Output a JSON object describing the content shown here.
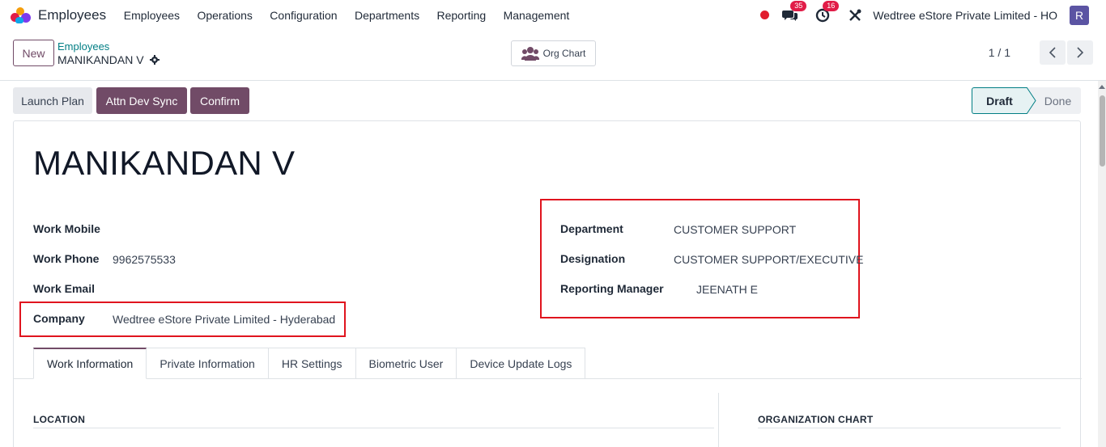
{
  "navbar": {
    "app_title": "Employees",
    "menu": [
      "Employees",
      "Operations",
      "Configuration",
      "Departments",
      "Reporting",
      "Management"
    ],
    "messages_count": "35",
    "activities_count": "16",
    "company": "Wedtree eStore Private Limited - HO",
    "avatar_initial": "R"
  },
  "control": {
    "new_label": "New",
    "breadcrumb": "Employees",
    "record_name": "MANIKANDAN V",
    "org_chart_label": "Org Chart",
    "pager": "1 / 1"
  },
  "statusbar": {
    "launch_plan": "Launch Plan",
    "attn_dev_sync": "Attn Dev Sync",
    "confirm": "Confirm",
    "stages": [
      "Draft",
      "Done"
    ],
    "current_stage": "Draft"
  },
  "form": {
    "employee_name": "MANIKANDAN V",
    "work_mobile_label": "Work Mobile",
    "work_mobile": "",
    "work_phone_label": "Work Phone",
    "work_phone": "9962575533",
    "work_email_label": "Work Email",
    "work_email": "",
    "company_label": "Company",
    "company": "Wedtree eStore Private Limited - Hyderabad",
    "department_label": "Department",
    "department": "CUSTOMER SUPPORT",
    "designation_label": "Designation",
    "designation": "CUSTOMER SUPPORT/EXECUTIVE",
    "reporting_manager_label": "Reporting Manager",
    "reporting_manager": "JEENATH E"
  },
  "tabs": [
    "Work Information",
    "Private Information",
    "HR Settings",
    "Biometric User",
    "Device Update Logs"
  ],
  "sections": {
    "location": "LOCATION",
    "org_chart": "ORGANIZATION CHART"
  },
  "colors": {
    "primary": "#714B67",
    "accent": "#017e84",
    "highlight": "#e0141e",
    "badge": "#e11d48"
  }
}
